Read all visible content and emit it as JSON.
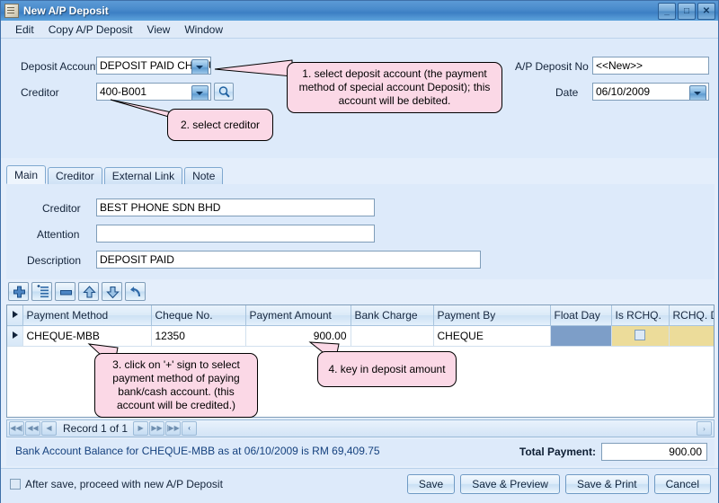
{
  "window": {
    "title": "New A/P Deposit",
    "icon": "document-icon",
    "buttons": [
      {
        "name": "minimize-button",
        "glyph": "_"
      },
      {
        "name": "maximize-button",
        "glyph": "□"
      },
      {
        "name": "close-button",
        "glyph": "✕"
      }
    ]
  },
  "menubar": {
    "items": [
      "Edit",
      "Copy A/P Deposit",
      "View",
      "Window"
    ]
  },
  "header": {
    "deposit_account_label": "Deposit Account",
    "deposit_account_value": "DEPOSIT PAID CHEQU",
    "creditor_label": "Creditor",
    "creditor_value": "400-B001",
    "ap_deposit_no_label": "A/P Deposit No",
    "ap_deposit_no_value": "<<New>>",
    "date_label": "Date",
    "date_value": "06/10/2009"
  },
  "tabs": [
    {
      "label": "Main",
      "active": true
    },
    {
      "label": "Creditor",
      "active": false
    },
    {
      "label": "External Link",
      "active": false
    },
    {
      "label": "Note",
      "active": false
    }
  ],
  "main_tab": {
    "creditor_label": "Creditor",
    "creditor_value": "BEST PHONE SDN BHD",
    "attention_label": "Attention",
    "attention_value": "",
    "description_label": "Description",
    "description_value": "DEPOSIT PAID"
  },
  "grid_toolbar": [
    {
      "name": "add-row-button",
      "icon": "plus-icon"
    },
    {
      "name": "insert-row-button",
      "icon": "insert-list-icon"
    },
    {
      "name": "delete-row-button",
      "icon": "minus-icon"
    },
    {
      "name": "move-up-button",
      "icon": "arrow-up-icon"
    },
    {
      "name": "move-down-button",
      "icon": "arrow-down-icon"
    },
    {
      "name": "undo-button",
      "icon": "undo-arrow-icon"
    }
  ],
  "grid": {
    "columns": [
      "Payment Method",
      "Cheque No.",
      "Payment Amount",
      "Bank Charge",
      "Payment By",
      "Float Day",
      "Is RCHQ.",
      "RCHQ. Date"
    ],
    "rows": [
      {
        "payment_method": "CHEQUE-MBB",
        "cheque_no": "12350",
        "payment_amount": "900.00",
        "bank_charge": "",
        "payment_by": "CHEQUE",
        "float_day": "",
        "is_rchq": false,
        "rchq_date": ""
      }
    ]
  },
  "record_nav": {
    "text": "Record 1 of 1",
    "buttons": [
      "◀◀|",
      "◀◀",
      "◀",
      "▶",
      "▶▶",
      "|▶▶",
      "‹"
    ],
    "right_button": "›"
  },
  "balance": {
    "text": "Bank Account Balance for CHEQUE-MBB as at 06/10/2009 is RM 69,409.75",
    "total_label": "Total Payment:",
    "total_value": "900.00"
  },
  "footer": {
    "after_save_label": "After save, proceed with new A/P Deposit",
    "after_save_checked": false,
    "buttons": [
      "Save",
      "Save & Preview",
      "Save & Print",
      "Cancel"
    ]
  },
  "callouts": [
    {
      "id": "callout-1",
      "text": "1. select deposit account (the payment method of special account Deposit); this account will be debited."
    },
    {
      "id": "callout-2",
      "text": "2. select creditor"
    },
    {
      "id": "callout-3",
      "text": "3. click on '+' sign to select payment method of paying bank/cash account. (this account will be credited.)"
    },
    {
      "id": "callout-4",
      "text": "4. key in deposit amount"
    }
  ],
  "colors": {
    "titlebar": "#4a8ccc",
    "form_bg": "#ddeafa",
    "callout_bg": "#fbd8e6",
    "selected_cell": "#7d9ec8",
    "yellow_cell": "#ecdc9a",
    "balance_text": "#15417e"
  }
}
